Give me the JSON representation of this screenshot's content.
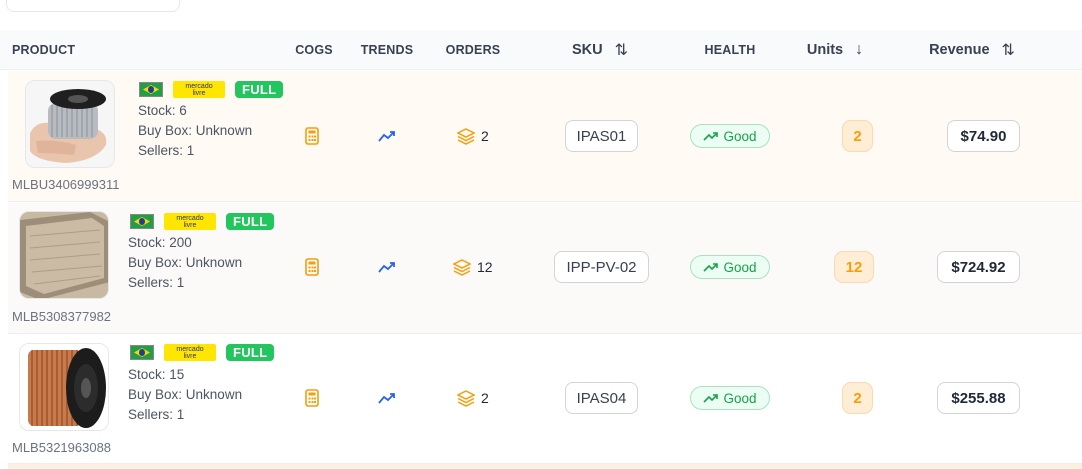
{
  "columns": {
    "product": "PRODUCT",
    "cogs": "COGS",
    "trends": "TRENDS",
    "orders": "ORDERS",
    "sku": "SKU",
    "health": "HEALTH",
    "units": "Units",
    "revenue": "Revenue"
  },
  "sort_icons": {
    "sku": "⇅",
    "units": "↓",
    "revenue": "⇅"
  },
  "badges": {
    "ml_text": "mercado livre",
    "full": "FULL"
  },
  "labels": {
    "stock": "Stock:",
    "buybox": "Buy Box:",
    "sellers": "Sellers:"
  },
  "rows": [
    {
      "id": "MLBU3406999311",
      "stock": "6",
      "buybox": "Unknown",
      "sellers": "1",
      "orders": "2",
      "sku": "IPAS01",
      "health": "Good",
      "units": "2",
      "revenue": "$74.90",
      "image": "aluminum-wire-spool"
    },
    {
      "id": "MLB5308377982",
      "stock": "200",
      "buybox": "Unknown",
      "sellers": "1",
      "orders": "12",
      "sku": "IPP-PV-02",
      "health": "Good",
      "units": "12",
      "revenue": "$724.92",
      "image": "wood-vinyl-plank"
    },
    {
      "id": "MLB5321963088",
      "stock": "15",
      "buybox": "Unknown",
      "sellers": "1",
      "orders": "2",
      "sku": "IPAS04",
      "health": "Good",
      "units": "2",
      "revenue": "$255.88",
      "image": "copper-wire-spool"
    }
  ],
  "colors": {
    "accent_orange": "#f59e0b",
    "good_green": "#16a34a",
    "trend_blue": "#2563eb",
    "full_green": "#22c55e"
  }
}
